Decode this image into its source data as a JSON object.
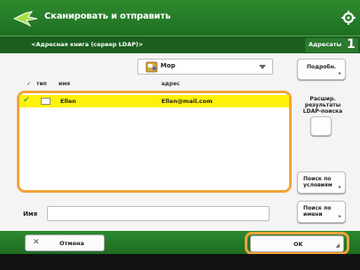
{
  "header": {
    "title": "Сканировать и отправить"
  },
  "subheader": {
    "breadcrumb": "<Адресная книга (сервер LDAP)>",
    "recipients_label": "Адресаты",
    "recipients_count": "1"
  },
  "address_book": {
    "selected_book": "Мор",
    "columns": {
      "type": "тип",
      "name": "имя",
      "address": "адрес"
    },
    "rows": [
      {
        "checked": "✔",
        "name": "Ellen",
        "address": "Ellen@mail.com"
      }
    ]
  },
  "side_buttons": {
    "details": "Подробн.",
    "show_ldap_results": "Расшир. результаты LDAP-поиска",
    "search_by_conditions": "Поиск по условиям",
    "search_by_name": "Поиск по имени"
  },
  "filter": {
    "label": "Имя",
    "value": ""
  },
  "actions": {
    "cancel": "Отмена",
    "ok": "OK"
  },
  "colors": {
    "header_green": "#2e8a2e",
    "highlight_row": "#fff20a",
    "focus_orange": "#f3a33a"
  }
}
